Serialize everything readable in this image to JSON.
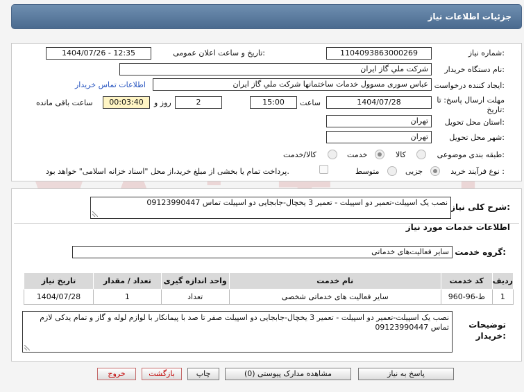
{
  "header": {
    "title": "جزئیات اطلاعات نیاز"
  },
  "labels": {
    "need_number": "شماره نیاز:",
    "announce_datetime": "تاریخ و ساعت اعلان عمومی:",
    "buyer_org": "نام دستگاه خریدار:",
    "requester": "ایجاد کننده درخواست:",
    "buyer_contact": "اطلاعات تماس خریدار",
    "deadline_1": "مهلت ارسال پاسخ: تا",
    "deadline_2": "تاریخ:",
    "time": "ساعت",
    "day_and": "روز و",
    "remaining": "ساعت باقی مانده",
    "province": "استان محل تحویل:",
    "city": "شهر محل تحویل:",
    "category": "طبقه بندی موضوعی:",
    "process_type": "نوع فرآیند خرید :",
    "payment_note": "پرداخت تمام یا بخشی از مبلغ خرید،از محل \"اسناد خزانه اسلامی\" خواهد بود.",
    "general_desc": "شرح کلی نیاز:",
    "services_info": "اطلاعات خدمات مورد نیاز",
    "service_group": "گروه خدمت:",
    "buyer_notes_1": "توضیحات",
    "buyer_notes_2": "خریدار:"
  },
  "fields": {
    "need_number": "1104093863000269",
    "announce_datetime": "1404/07/26 - 12:35",
    "buyer_org": "شرکت ملي گاز ايران",
    "requester": "عباس سوری مسوول خدمات ساختمانها  شرکت ملي گاز ايران",
    "deadline_date": "1404/07/28",
    "deadline_time": "15:00",
    "days": "2",
    "remaining_time": "00:03:40",
    "province": "تهران",
    "city": "تهران",
    "general_desc": "نصب یک اسپیلت-تعمیر دو اسپیلت - تعمیر 3 یخچال-جابجایی دو اسپیلت تماس 09123990447",
    "service_group": "سایر فعالیت‌های خدماتی",
    "buyer_notes": "نصب یک اسپیلت-تعمیر دو اسپیلت - تعمیر 3 یخچال-جابجایی دو اسپیلت صفر تا صد با پیمانکار با لوازم لوله و گاز و تمام یدکی لازم تماس 09123990447"
  },
  "category_options": [
    {
      "label": "کالا",
      "selected": false
    },
    {
      "label": "خدمت",
      "selected": true
    },
    {
      "label": "کالا/خدمت",
      "selected": false
    }
  ],
  "process_options": [
    {
      "label": "جزیی",
      "selected": true
    },
    {
      "label": "متوسط",
      "selected": false
    }
  ],
  "table": {
    "headers": [
      "ردیف",
      "کد خدمت",
      "نام خدمت",
      "واحد اندازه گیری",
      "تعداد / مقدار",
      "تاریخ نیاز"
    ],
    "rows": [
      [
        "1",
        "ط-96-960",
        "سایر فعالیت های خدماتی شخصی",
        "تعداد",
        "1",
        "1404/07/28"
      ]
    ]
  },
  "buttons": {
    "reply": "پاسخ به نیاز",
    "attachments": "مشاهده مدارک پیوستی (0)",
    "print": "چاپ",
    "back": "بازگشت",
    "exit": "خروج"
  },
  "watermark": "AriaTender.net",
  "colors": {
    "header": "#5a7a9e",
    "link": "#2855c0",
    "exit_text": "#c20000"
  }
}
